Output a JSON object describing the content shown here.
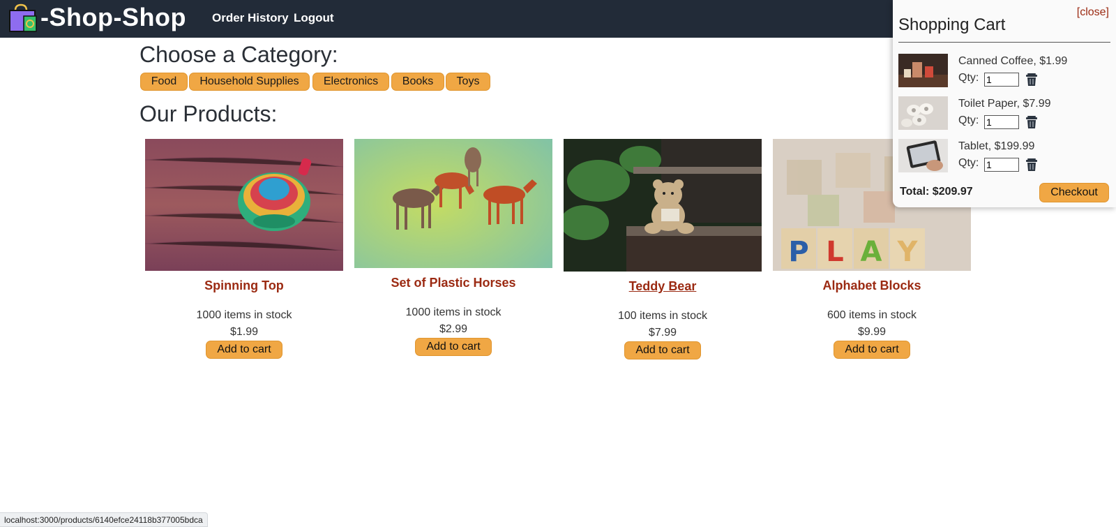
{
  "header": {
    "brand": "-Shop-Shop",
    "nav": [
      "Order History",
      "Logout"
    ],
    "bg_color": "#222b38"
  },
  "categories": {
    "title": "Choose a Category:",
    "items": [
      "Food",
      "Household Supplies",
      "Electronics",
      "Books",
      "Toys"
    ]
  },
  "products": {
    "title": "Our Products:",
    "items": [
      {
        "name": "Spinning Top",
        "stock": "1000 items in stock",
        "price": "$1.99",
        "button": "Add to cart"
      },
      {
        "name": "Set of Plastic Horses",
        "stock": "1000 items in stock",
        "price": "$2.99",
        "button": "Add to cart"
      },
      {
        "name": "Teddy Bear",
        "stock": "100 items in stock",
        "price": "$7.99",
        "button": "Add to cart"
      },
      {
        "name": "Alphabet Blocks",
        "stock": "600 items in stock",
        "price": "$9.99",
        "button": "Add to cart"
      }
    ]
  },
  "cart": {
    "close": "[close]",
    "title": "Shopping Cart",
    "qty_label": "Qty:",
    "items": [
      {
        "name": "Canned Coffee, $1.99",
        "qty": "1"
      },
      {
        "name": "Toilet Paper, $7.99",
        "qty": "1"
      },
      {
        "name": "Tablet, $199.99",
        "qty": "1"
      }
    ],
    "total": "Total: $209.97",
    "checkout": "Checkout"
  },
  "status_bar": {
    "url": "localhost:3000/products/6140efce24118b377005bdca"
  },
  "colors": {
    "accent": "#f0a744",
    "product_name": "#9b2a12"
  }
}
